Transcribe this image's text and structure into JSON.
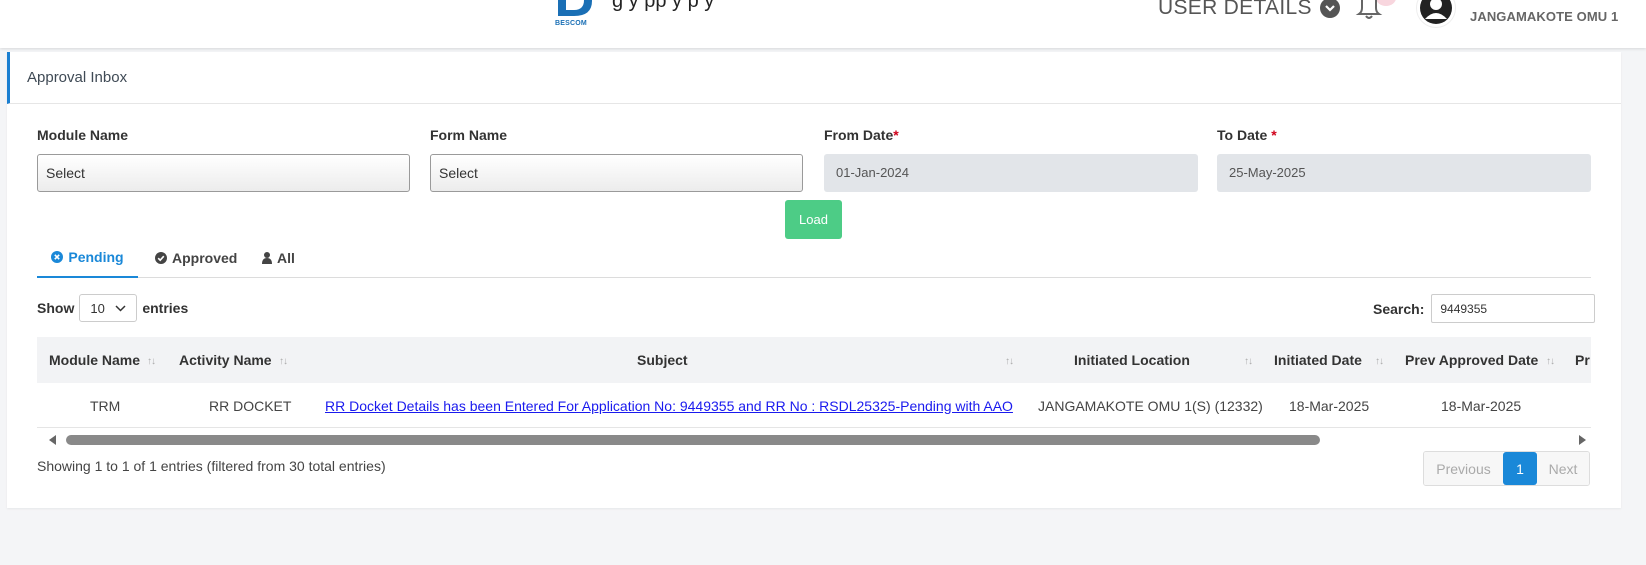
{
  "header": {
    "logo_text": "BESCOM",
    "company_partial": "g          y  pp y  p  y",
    "user_details_label": "USER DETAILS",
    "user_name": "JANGAMAKOTE OMU 1"
  },
  "card": {
    "title": "Approval Inbox"
  },
  "filters": {
    "module_label": "Module Name",
    "module_value": "Select",
    "form_label": "Form Name",
    "form_value": "Select",
    "from_label": "From Date",
    "from_value": "01-Jan-2024",
    "to_label": "To Date",
    "to_value": "25-May-2025",
    "required_mark": "*",
    "load_label": "Load"
  },
  "tabs": [
    {
      "label": "Pending",
      "icon": "times-circle-icon"
    },
    {
      "label": "Approved",
      "icon": "check-circle-icon"
    },
    {
      "label": "All",
      "icon": "user-icon"
    }
  ],
  "table_controls": {
    "show_label": "Show",
    "page_length": "10",
    "entries_label": "entries",
    "search_label": "Search:",
    "search_value": "9449355"
  },
  "table": {
    "columns": [
      "Module Name",
      "Activity Name",
      "Subject",
      "Initiated Location",
      "Initiated Date",
      "Prev Approved Date",
      "Pr"
    ],
    "rows": [
      {
        "module": "TRM",
        "activity": "RR DOCKET",
        "subject": "RR Docket Details has been Entered For Application No: 9449355 and RR No : RSDL25325-Pending with AAO",
        "location": "JANGAMAKOTE OMU 1(S) (12332)",
        "initiated_date": "18-Mar-2025",
        "prev_approved_date": "18-Mar-2025"
      }
    ]
  },
  "footer": {
    "info": "Showing 1 to 1 of 1 entries (filtered from 30 total entries)",
    "prev_label": "Previous",
    "page": "1",
    "next_label": "Next"
  },
  "colors": {
    "accent": "#1a88d8",
    "load_button": "#4dcc86",
    "link": "#1a1aee"
  }
}
